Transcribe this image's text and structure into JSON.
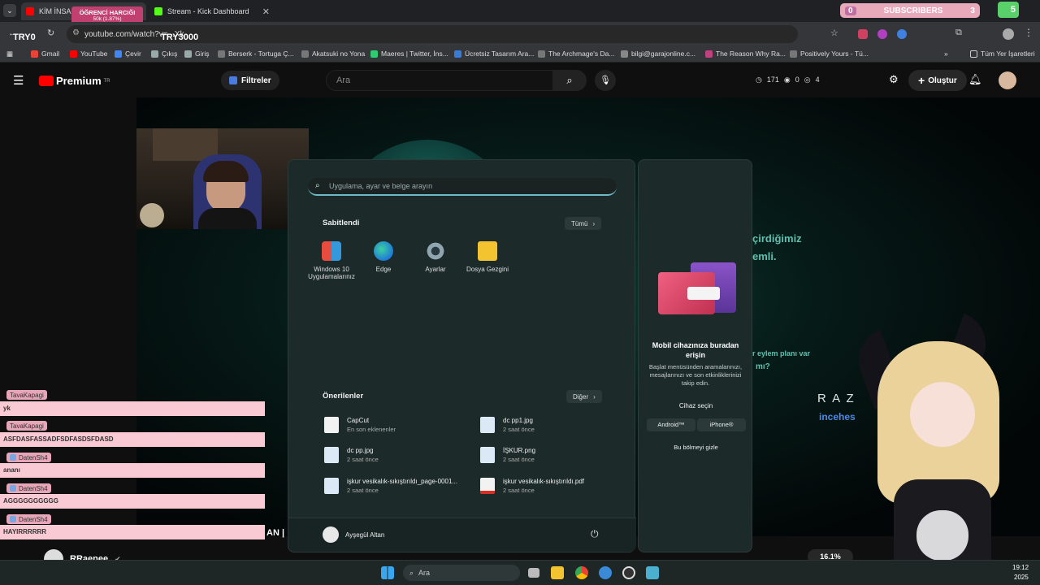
{
  "browser": {
    "tabs": [
      {
        "label": "KİM İNSAN, KİM DEĞİL...",
        "active": true
      },
      {
        "label": "Stream - Kick Dashboard",
        "active": false
      }
    ],
    "url": "youtube.com/watch?v=...Xk",
    "overlay": {
      "label": "ÖĞRENCİ HARCIĞI",
      "sub": "50k (1.87%)",
      "left_tag": "TRY0",
      "right_tag": "TRY3000"
    },
    "subscribers": {
      "label": "SUBSCRIBERS",
      "left": "0",
      "right": "3",
      "badge": "5"
    },
    "bookmarks": [
      "Gmail",
      "YouTube",
      "Çevir",
      "Çıkış",
      "Giriş",
      "Berserk - Tortuga Ç...",
      "Akatsuki no Yona",
      "Maeres | Twitter, İns...",
      "Ücretsiz Tasarım Ara...",
      "The Archmage's Da...",
      "bilgi@garajonline.c...",
      "The Reason Why Ra...",
      "Positively Yours - Tü...",
      "Tüm Yer İşaretleri"
    ]
  },
  "youtube": {
    "logo": "Premium",
    "logo_sup": "TR",
    "filters": "Filtreler",
    "search_placeholder": "Ara",
    "stats": {
      "a": "171",
      "b": "0",
      "c": "4"
    },
    "create": "Oluştur",
    "channel": "RRaenee",
    "zoom": "16.1%"
  },
  "video_overlay": {
    "line1": "çirdiğimiz",
    "line2": "emli.",
    "line3": "r eylem planı var",
    "line4": "mı?",
    "brand": "R A Z",
    "brand_sub": "incehes",
    "bottom_text": "AN |"
  },
  "startmenu": {
    "search_placeholder": "Uygulama, ayar ve belge arayın",
    "pinned_title": "Sabitlendi",
    "all_btn": "Tümü",
    "pinned": [
      {
        "label": "Windows 10 Uygulamalarınız",
        "icon": "windows-apps-icon"
      },
      {
        "label": "Edge",
        "icon": "edge-icon"
      },
      {
        "label": "Ayarlar",
        "icon": "settings-gear-icon"
      },
      {
        "label": "Dosya Gezgini",
        "icon": "folder-icon"
      }
    ],
    "recommended_title": "Önerilenler",
    "more_btn": "Diğer",
    "recommended": [
      {
        "title": "CapCut",
        "sub": "En son eklenenler"
      },
      {
        "title": "dc pp1.jpg",
        "sub": "2 saat önce"
      },
      {
        "title": "dc pp.jpg",
        "sub": "2 saat önce"
      },
      {
        "title": "İŞKUR.png",
        "sub": "2 saat önce"
      },
      {
        "title": "işkur vesikalık-sıkıştırıldı_page-0001...",
        "sub": "2 saat önce"
      },
      {
        "title": "işkur vesikalık-sıkıştırıldı.pdf",
        "sub": "2 saat önce"
      }
    ],
    "user": "Ayşegül Altan"
  },
  "sidepanel": {
    "title": "Mobil cihazınıza buradan erişin",
    "desc": "Başlat menüsünden aramalarınızı, mesajlarınızı ve son etkinliklerinizi takip edin.",
    "pick": "Cihaz seçin",
    "android": "Android™",
    "iphone": "iPhone®",
    "hide": "Bu bölmeyi gizle"
  },
  "chat": [
    {
      "name": "TavaKapagi",
      "msg": "yk"
    },
    {
      "name": "TavaKapagi",
      "msg": "ASFDASFASSADFSDFASDSFDASD"
    },
    {
      "name": "DatenSh4",
      "msg": "ananı"
    },
    {
      "name": "DatenSh4",
      "msg": "AGGGGGGGGGG"
    },
    {
      "name": "DatenSh4",
      "msg": "HAYIRRRRRR"
    }
  ],
  "taskbar": {
    "search": "Ara",
    "time": "19:12",
    "date": "2025"
  },
  "colors": {
    "accent": "#6fb8c8",
    "startmenu_bg": "#1c2b2a",
    "chat_pink": "#f9c9d4"
  }
}
